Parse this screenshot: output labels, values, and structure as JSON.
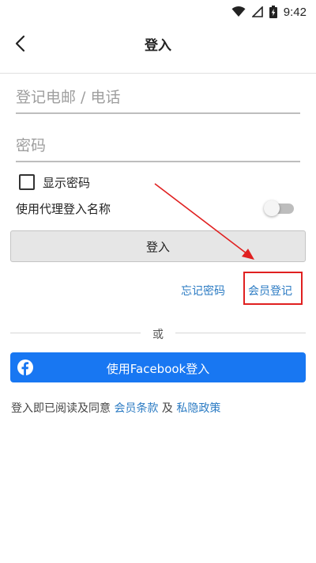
{
  "status_bar": {
    "time": "9:42",
    "icons": [
      "wifi-icon",
      "signal-icon",
      "battery-charging-icon"
    ]
  },
  "header": {
    "title": "登入",
    "back_icon": "chevron-left-icon"
  },
  "form": {
    "email_placeholder": "登记电邮 / 电话",
    "password_placeholder": "密码",
    "show_password_label": "显示密码",
    "proxy_login_label": "使用代理登入名称",
    "proxy_toggle_on": false,
    "login_button_label": "登入"
  },
  "links": {
    "forgot_password": "忘记密码",
    "register": "会员登记"
  },
  "divider": {
    "or_text": "或"
  },
  "facebook": {
    "button_label": "使用Facebook登入",
    "color": "#1877f2"
  },
  "terms": {
    "prefix": "登入即已阅读及同意",
    "member_terms": "会员条款",
    "and": "及",
    "privacy_policy": "私隐政策"
  },
  "colors": {
    "link": "#2b7bc3",
    "annotation": "#e02020"
  }
}
